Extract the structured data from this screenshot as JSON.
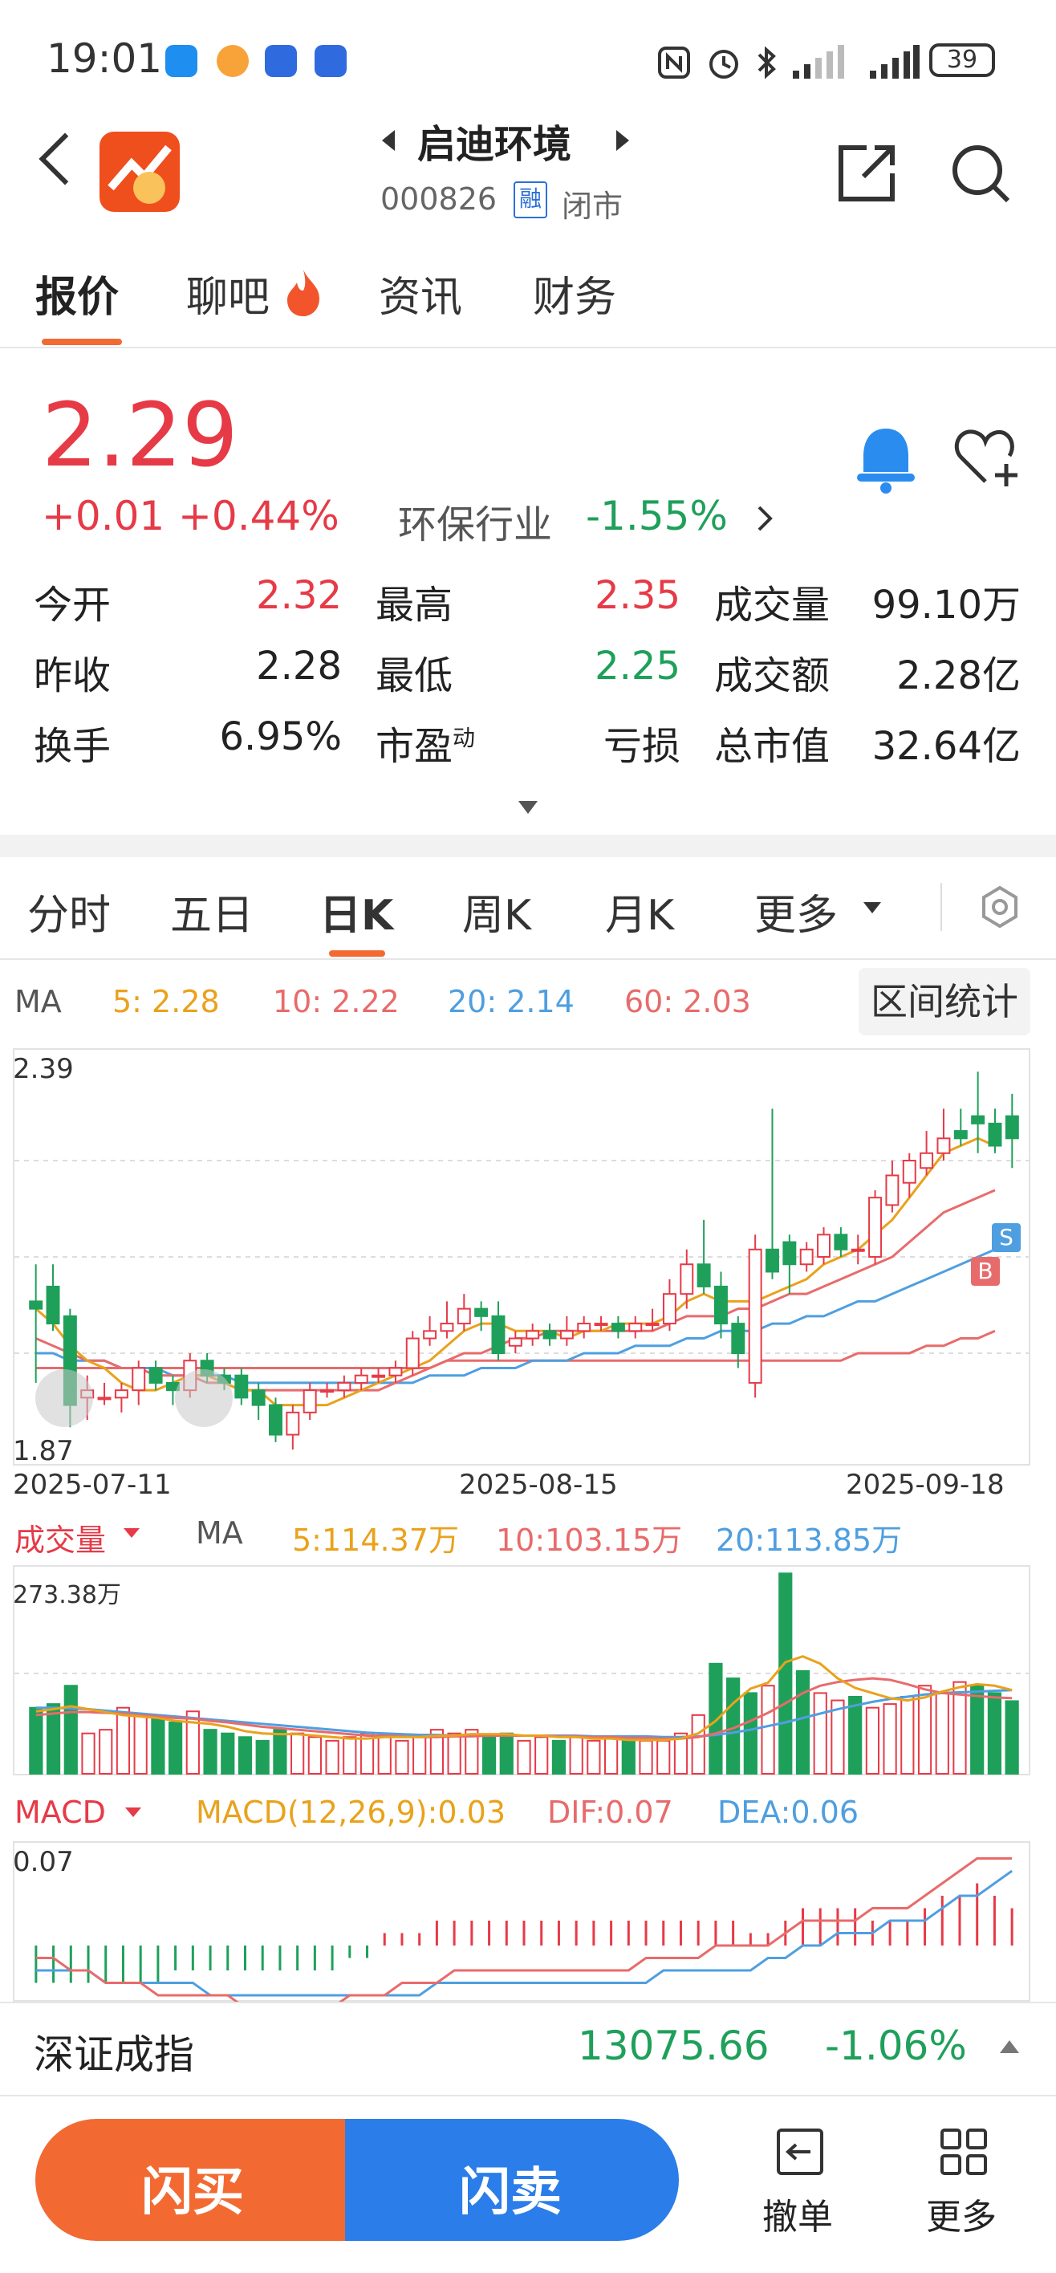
{
  "status_bar": {
    "time": "19:01",
    "battery": "39"
  },
  "header": {
    "name": "启迪环境",
    "code": "000826",
    "margin_badge": "融",
    "market_status": "闭市"
  },
  "tabs": [
    {
      "label": "报价"
    },
    {
      "label": "聊吧"
    },
    {
      "label": "资讯"
    },
    {
      "label": "财务"
    }
  ],
  "quote": {
    "price": "2.29",
    "change": "+0.01",
    "change_pct": "+0.44%",
    "industry_label": "环保行业",
    "industry_pct": "-1.55%",
    "rows": [
      [
        {
          "label": "今开",
          "value": "2.32"
        },
        {
          "label": "最高",
          "value": "2.35"
        },
        {
          "label": "成交量",
          "value": "99.10万"
        }
      ],
      [
        {
          "label": "昨收",
          "value": "2.28"
        },
        {
          "label": "最低",
          "value": "2.25"
        },
        {
          "label": "成交额",
          "value": "2.28亿"
        }
      ],
      [
        {
          "label": "换手",
          "value": "6.95%"
        },
        {
          "label": "市盈",
          "sup": "动",
          "value": "亏损"
        },
        {
          "label": "总市值",
          "value": "32.64亿"
        }
      ]
    ]
  },
  "chart_tabs": [
    {
      "label": "分时"
    },
    {
      "label": "五日"
    },
    {
      "label": "日K"
    },
    {
      "label": "周K"
    },
    {
      "label": "月K"
    },
    {
      "label": "更多"
    }
  ],
  "ma": {
    "label": "MA",
    "ma5": "5:  2.28",
    "ma10": "10:  2.22",
    "ma20": "20:  2.14",
    "ma60": "60:  2.03",
    "range_button": "区间统计"
  },
  "kline": {
    "ymax_label": "2.39",
    "ymin_label": "1.87",
    "dates": [
      "2025-07-11",
      "2025-08-15",
      "2025-09-18"
    ],
    "sell_marker": "S",
    "buy_marker": "B"
  },
  "volume": {
    "label": "成交量",
    "ma_label": "MA",
    "ma5": "5:114.37万",
    "ma10": "10:103.15万",
    "ma20": "20:113.85万",
    "ymax_label": "273.38万"
  },
  "macd": {
    "label": "MACD",
    "params": "MACD(12,26,9):0.03",
    "dif": "DIF:0.07",
    "dea": "DEA:0.06",
    "ymax_label": "0.07"
  },
  "index_bar": {
    "name": "深证成指",
    "value": "13075.66",
    "pct": "-1.06%"
  },
  "bottom": {
    "buy": "闪买",
    "sell": "闪卖",
    "cancel": "撤单",
    "more": "更多"
  },
  "colors": {
    "up": "#e63a47",
    "down": "#1ea05a",
    "accent": "#f26a32",
    "sell_blue": "#2b7de9",
    "ma5": "#e9a21c",
    "ma10": "#e86b6b",
    "ma20": "#4f9fe0",
    "ma60": "#e86b6b"
  },
  "chart_data": {
    "type": "candlestick",
    "candles": [
      {
        "o": 2.07,
        "c": 2.06,
        "h": 2.12,
        "l": 1.96
      },
      {
        "o": 2.09,
        "c": 2.04,
        "h": 2.12,
        "l": 2.03
      },
      {
        "o": 2.05,
        "c": 1.93,
        "h": 2.06,
        "l": 1.9
      },
      {
        "o": 1.94,
        "c": 1.95,
        "h": 1.97,
        "l": 1.91
      },
      {
        "o": 1.94,
        "c": 1.94,
        "h": 1.96,
        "l": 1.93
      },
      {
        "o": 1.94,
        "c": 1.95,
        "h": 1.96,
        "l": 1.92
      },
      {
        "o": 1.95,
        "c": 1.98,
        "h": 1.99,
        "l": 1.93
      },
      {
        "o": 1.98,
        "c": 1.96,
        "h": 1.99,
        "l": 1.95
      },
      {
        "o": 1.96,
        "c": 1.95,
        "h": 1.97,
        "l": 1.93
      },
      {
        "o": 1.95,
        "c": 1.99,
        "h": 2.0,
        "l": 1.94
      },
      {
        "o": 1.99,
        "c": 1.97,
        "h": 2.0,
        "l": 1.96
      },
      {
        "o": 1.97,
        "c": 1.96,
        "h": 1.98,
        "l": 1.95
      },
      {
        "o": 1.97,
        "c": 1.94,
        "h": 1.98,
        "l": 1.93
      },
      {
        "o": 1.95,
        "c": 1.93,
        "h": 1.96,
        "l": 1.91
      },
      {
        "o": 1.93,
        "c": 1.89,
        "h": 1.94,
        "l": 1.88
      },
      {
        "o": 1.89,
        "c": 1.92,
        "h": 1.93,
        "l": 1.87
      },
      {
        "o": 1.92,
        "c": 1.95,
        "h": 1.96,
        "l": 1.91
      },
      {
        "o": 1.95,
        "c": 1.95,
        "h": 1.96,
        "l": 1.94
      },
      {
        "o": 1.95,
        "c": 1.96,
        "h": 1.97,
        "l": 1.94
      },
      {
        "o": 1.96,
        "c": 1.97,
        "h": 1.98,
        "l": 1.95
      },
      {
        "o": 1.97,
        "c": 1.97,
        "h": 1.98,
        "l": 1.96
      },
      {
        "o": 1.97,
        "c": 1.98,
        "h": 1.99,
        "l": 1.96
      },
      {
        "o": 1.98,
        "c": 2.02,
        "h": 2.03,
        "l": 1.97
      },
      {
        "o": 2.02,
        "c": 2.03,
        "h": 2.05,
        "l": 2.01
      },
      {
        "o": 2.03,
        "c": 2.04,
        "h": 2.07,
        "l": 2.02
      },
      {
        "o": 2.04,
        "c": 2.06,
        "h": 2.08,
        "l": 2.03
      },
      {
        "o": 2.06,
        "c": 2.05,
        "h": 2.07,
        "l": 2.03
      },
      {
        "o": 2.05,
        "c": 2.0,
        "h": 2.07,
        "l": 1.99
      },
      {
        "o": 2.01,
        "c": 2.02,
        "h": 2.03,
        "l": 2.0
      },
      {
        "o": 2.02,
        "c": 2.03,
        "h": 2.04,
        "l": 2.01
      },
      {
        "o": 2.03,
        "c": 2.02,
        "h": 2.04,
        "l": 2.01
      },
      {
        "o": 2.02,
        "c": 2.03,
        "h": 2.05,
        "l": 2.01
      },
      {
        "o": 2.03,
        "c": 2.04,
        "h": 2.05,
        "l": 2.02
      },
      {
        "o": 2.04,
        "c": 2.04,
        "h": 2.05,
        "l": 2.03
      },
      {
        "o": 2.04,
        "c": 2.03,
        "h": 2.05,
        "l": 2.02
      },
      {
        "o": 2.03,
        "c": 2.04,
        "h": 2.05,
        "l": 2.02
      },
      {
        "o": 2.04,
        "c": 2.04,
        "h": 2.06,
        "l": 2.03
      },
      {
        "o": 2.04,
        "c": 2.08,
        "h": 2.1,
        "l": 2.03
      },
      {
        "o": 2.08,
        "c": 2.12,
        "h": 2.14,
        "l": 2.06
      },
      {
        "o": 2.12,
        "c": 2.09,
        "h": 2.18,
        "l": 2.08
      },
      {
        "o": 2.09,
        "c": 2.04,
        "h": 2.11,
        "l": 2.02
      },
      {
        "o": 2.04,
        "c": 2.0,
        "h": 2.05,
        "l": 1.98
      },
      {
        "o": 1.96,
        "c": 2.14,
        "h": 2.16,
        "l": 1.94
      },
      {
        "o": 2.14,
        "c": 2.11,
        "h": 2.33,
        "l": 2.1
      },
      {
        "o": 2.15,
        "c": 2.12,
        "h": 2.16,
        "l": 2.08
      },
      {
        "o": 2.12,
        "c": 2.14,
        "h": 2.15,
        "l": 2.11
      },
      {
        "o": 2.13,
        "c": 2.16,
        "h": 2.17,
        "l": 2.12
      },
      {
        "o": 2.16,
        "c": 2.14,
        "h": 2.17,
        "l": 2.13
      },
      {
        "o": 2.14,
        "c": 2.14,
        "h": 2.16,
        "l": 2.12
      },
      {
        "o": 2.13,
        "c": 2.21,
        "h": 2.22,
        "l": 2.12
      },
      {
        "o": 2.2,
        "c": 2.24,
        "h": 2.26,
        "l": 2.19
      },
      {
        "o": 2.23,
        "c": 2.26,
        "h": 2.27,
        "l": 2.21
      },
      {
        "o": 2.25,
        "c": 2.27,
        "h": 2.3,
        "l": 2.24
      },
      {
        "o": 2.27,
        "c": 2.29,
        "h": 2.33,
        "l": 2.26
      },
      {
        "o": 2.3,
        "c": 2.29,
        "h": 2.33,
        "l": 2.28
      },
      {
        "o": 2.32,
        "c": 2.31,
        "h": 2.38,
        "l": 2.27
      },
      {
        "o": 2.31,
        "c": 2.28,
        "h": 2.33,
        "l": 2.27
      },
      {
        "o": 2.32,
        "c": 2.29,
        "h": 2.35,
        "l": 2.25
      }
    ],
    "ma5": [
      2.06,
      2.04,
      2.01,
      1.99,
      1.98,
      1.96,
      1.95,
      1.95,
      1.96,
      1.97,
      1.97,
      1.96,
      1.95,
      1.95,
      1.93,
      1.93,
      1.93,
      1.93,
      1.94,
      1.95,
      1.96,
      1.97,
      1.98,
      1.99,
      2.01,
      2.03,
      2.04,
      2.04,
      2.03,
      2.03,
      2.03,
      2.02,
      2.03,
      2.03,
      2.04,
      2.04,
      2.04,
      2.05,
      2.07,
      2.08,
      2.07,
      2.07,
      2.07,
      2.08,
      2.09,
      2.1,
      2.12,
      2.13,
      2.14,
      2.16,
      2.18,
      2.21,
      2.24,
      2.27,
      2.28,
      2.29,
      2.28
    ],
    "ma10": [
      2.02,
      2.01,
      2.0,
      1.99,
      1.99,
      1.98,
      1.98,
      1.97,
      1.97,
      1.97,
      1.96,
      1.96,
      1.95,
      1.95,
      1.95,
      1.95,
      1.95,
      1.95,
      1.95,
      1.95,
      1.95,
      1.96,
      1.97,
      1.98,
      1.99,
      2.0,
      2.0,
      2.01,
      2.02,
      2.02,
      2.03,
      2.03,
      2.03,
      2.03,
      2.03,
      2.03,
      2.03,
      2.04,
      2.05,
      2.05,
      2.05,
      2.06,
      2.06,
      2.07,
      2.08,
      2.08,
      2.09,
      2.1,
      2.11,
      2.12,
      2.13,
      2.15,
      2.17,
      2.19,
      2.2,
      2.21,
      2.22
    ],
    "ma20": [
      2.0,
      2.0,
      1.99,
      1.99,
      1.99,
      1.98,
      1.98,
      1.98,
      1.97,
      1.97,
      1.97,
      1.97,
      1.96,
      1.96,
      1.96,
      1.96,
      1.96,
      1.96,
      1.96,
      1.96,
      1.96,
      1.96,
      1.96,
      1.97,
      1.97,
      1.97,
      1.98,
      1.98,
      1.98,
      1.99,
      1.99,
      1.99,
      2.0,
      2.0,
      2.0,
      2.01,
      2.01,
      2.01,
      2.02,
      2.02,
      2.03,
      2.03,
      2.03,
      2.04,
      2.04,
      2.05,
      2.05,
      2.06,
      2.07,
      2.07,
      2.08,
      2.09,
      2.1,
      2.11,
      2.12,
      2.13,
      2.14
    ],
    "ma60": [
      1.98,
      1.98,
      1.98,
      1.98,
      1.98,
      1.98,
      1.98,
      1.98,
      1.98,
      1.98,
      1.98,
      1.98,
      1.98,
      1.98,
      1.98,
      1.98,
      1.98,
      1.98,
      1.98,
      1.98,
      1.98,
      1.98,
      1.98,
      1.98,
      1.99,
      1.99,
      1.99,
      1.99,
      1.99,
      1.99,
      1.99,
      1.99,
      1.99,
      1.99,
      1.99,
      1.99,
      1.99,
      1.99,
      1.99,
      1.99,
      1.99,
      1.99,
      1.99,
      1.99,
      1.99,
      1.99,
      1.99,
      1.99,
      2.0,
      2.0,
      2.0,
      2.0,
      2.01,
      2.01,
      2.02,
      2.02,
      2.03
    ],
    "volume": [
      90,
      95,
      120,
      55,
      60,
      90,
      80,
      75,
      70,
      85,
      60,
      55,
      50,
      45,
      60,
      55,
      50,
      45,
      50,
      55,
      50,
      45,
      50,
      60,
      55,
      60,
      50,
      55,
      45,
      50,
      45,
      50,
      45,
      50,
      45,
      45,
      45,
      55,
      80,
      150,
      130,
      110,
      120,
      273,
      140,
      110,
      100,
      105,
      90,
      95,
      105,
      120,
      110,
      125,
      120,
      110,
      99
    ],
    "vol_ma5": [
      85,
      88,
      92,
      88,
      84,
      80,
      78,
      76,
      72,
      70,
      68,
      64,
      58,
      55,
      54,
      54,
      52,
      50,
      48,
      48,
      50,
      50,
      50,
      52,
      52,
      54,
      54,
      54,
      52,
      52,
      50,
      50,
      48,
      48,
      46,
      46,
      46,
      48,
      55,
      72,
      96,
      116,
      124,
      152,
      160,
      150,
      130,
      117,
      110,
      103,
      100,
      104,
      112,
      118,
      122,
      120,
      114
    ],
    "vol_ma10": [
      80,
      82,
      84,
      84,
      83,
      82,
      80,
      78,
      76,
      75,
      72,
      70,
      67,
      64,
      62,
      60,
      58,
      56,
      54,
      52,
      52,
      51,
      50,
      50,
      51,
      51,
      52,
      52,
      52,
      52,
      51,
      51,
      50,
      50,
      49,
      49,
      48,
      48,
      50,
      55,
      62,
      72,
      83,
      96,
      110,
      120,
      125,
      128,
      130,
      128,
      122,
      115,
      110,
      108,
      106,
      104,
      103
    ],
    "vol_ma20": [
      90,
      90,
      89,
      88,
      86,
      84,
      82,
      80,
      78,
      76,
      74,
      72,
      70,
      68,
      66,
      64,
      62,
      60,
      58,
      56,
      55,
      54,
      53,
      53,
      52,
      52,
      52,
      52,
      52,
      52,
      52,
      52,
      51,
      51,
      51,
      51,
      50,
      50,
      51,
      53,
      56,
      60,
      65,
      70,
      76,
      82,
      88,
      93,
      98,
      102,
      105,
      108,
      110,
      111,
      112,
      113,
      114
    ],
    "macd_hist": [
      -0.03,
      -0.03,
      -0.03,
      -0.03,
      -0.03,
      -0.03,
      -0.03,
      -0.03,
      -0.02,
      -0.02,
      -0.02,
      -0.02,
      -0.02,
      -0.02,
      -0.02,
      -0.02,
      -0.02,
      -0.02,
      -0.01,
      -0.01,
      0.01,
      0.01,
      0.01,
      0.02,
      0.02,
      0.02,
      0.02,
      0.02,
      0.02,
      0.02,
      0.02,
      0.02,
      0.02,
      0.02,
      0.02,
      0.02,
      0.02,
      0.02,
      0.02,
      0.02,
      0.02,
      0.01,
      0.01,
      0.02,
      0.03,
      0.03,
      0.03,
      0.03,
      0.02,
      0.02,
      0.02,
      0.03,
      0.04,
      0.04,
      0.05,
      0.04,
      0.03
    ],
    "dif": [
      -0.01,
      -0.01,
      -0.02,
      -0.02,
      -0.03,
      -0.03,
      -0.03,
      -0.04,
      -0.04,
      -0.04,
      -0.04,
      -0.04,
      -0.05,
      -0.05,
      -0.05,
      -0.05,
      -0.05,
      -0.05,
      -0.04,
      -0.04,
      -0.04,
      -0.03,
      -0.03,
      -0.03,
      -0.02,
      -0.02,
      -0.02,
      -0.02,
      -0.02,
      -0.02,
      -0.02,
      -0.02,
      -0.02,
      -0.02,
      -0.02,
      -0.01,
      -0.01,
      -0.01,
      -0.01,
      0.0,
      0.0,
      0.0,
      0.0,
      0.01,
      0.02,
      0.02,
      0.02,
      0.02,
      0.03,
      0.03,
      0.03,
      0.04,
      0.05,
      0.06,
      0.07,
      0.07,
      0.07
    ],
    "dea": [
      -0.02,
      -0.02,
      -0.02,
      -0.02,
      -0.03,
      -0.03,
      -0.03,
      -0.03,
      -0.03,
      -0.03,
      -0.04,
      -0.04,
      -0.04,
      -0.04,
      -0.04,
      -0.04,
      -0.04,
      -0.04,
      -0.04,
      -0.04,
      -0.04,
      -0.04,
      -0.04,
      -0.03,
      -0.03,
      -0.03,
      -0.03,
      -0.03,
      -0.03,
      -0.03,
      -0.03,
      -0.03,
      -0.03,
      -0.03,
      -0.03,
      -0.03,
      -0.02,
      -0.02,
      -0.02,
      -0.02,
      -0.02,
      -0.02,
      -0.01,
      -0.01,
      0.0,
      0.0,
      0.01,
      0.01,
      0.01,
      0.02,
      0.02,
      0.02,
      0.03,
      0.04,
      0.04,
      0.05,
      0.06
    ],
    "kline_ylim": [
      1.87,
      2.39
    ],
    "volume_ymax": 273.38,
    "x_labels": [
      "2025-07-11",
      "2025-08-15",
      "2025-09-18"
    ]
  }
}
